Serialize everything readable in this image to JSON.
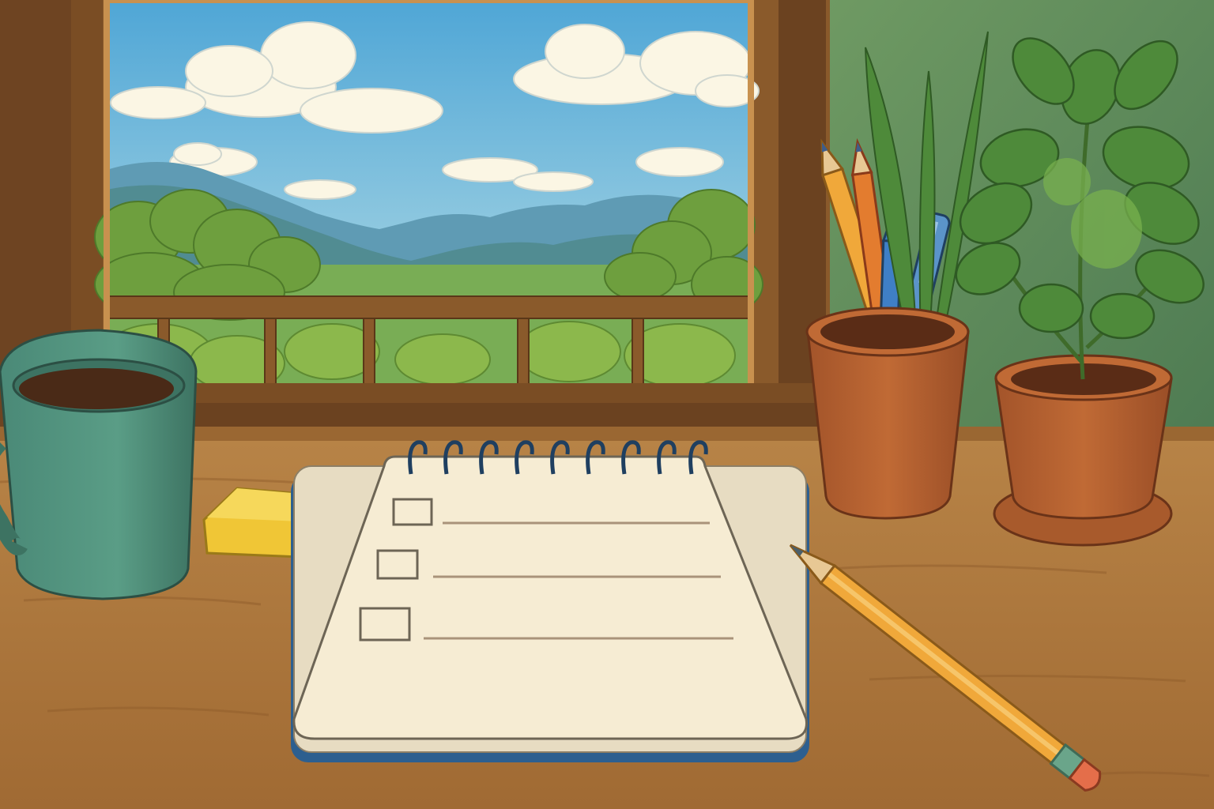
{
  "scene": {
    "description_free": true,
    "colors": {
      "sky_top": "#4fa6d6",
      "sky_bottom": "#b9dfe6",
      "cloud": "#fbf6e4",
      "mountain_far": "#5f9bb4",
      "mountain_near": "#4f8a8c",
      "field": "#79ad55",
      "foliage": "#6e9f3e",
      "foliage_light": "#9cc25a",
      "wood_frame": "#8a5a2b",
      "wood_frame_dark": "#6b4220",
      "wall": "#5f8a57",
      "desk": "#b07a3f",
      "desk_dark": "#8d5b2a",
      "mug": "#4e8f7a",
      "coffee": "#4a2a17",
      "eraser": "#f0c636",
      "notepad_paper": "#f6ecd3",
      "notepad_cover": "#2d5f8f",
      "spiral": "#1f3f60",
      "pot": "#b8622f",
      "leaf": "#4e8a3a",
      "leaf_light": "#78b04e",
      "pencil_body": "#f0a83a",
      "pencil_wood": "#e8c894",
      "pencil_lead": "#4a5f6a",
      "pencil_eraser": "#e46e4a",
      "pencil_ferrule": "#6aa58a",
      "blue_pen": "#3f7fc6",
      "orange_pencil": "#e37c2f",
      "checkbox_line": "#6d6555",
      "writing_line": "#a9937a"
    },
    "notepad": {
      "checklist_count": 3,
      "spiral_ring_count": 9
    }
  }
}
